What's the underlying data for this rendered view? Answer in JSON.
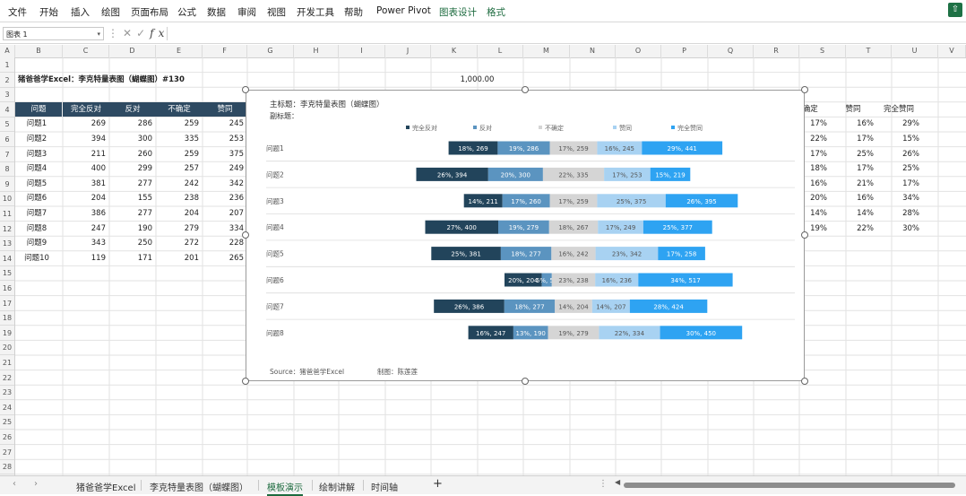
{
  "ribbon": {
    "tabs": [
      "文件",
      "开始",
      "插入",
      "绘图",
      "页面布局",
      "公式",
      "数据",
      "审阅",
      "视图",
      "开发工具",
      "帮助",
      "Power Pivot",
      "图表设计",
      "格式"
    ]
  },
  "formula_bar": {
    "name_box": "图表 1",
    "content": ""
  },
  "columns": [
    "A",
    "B",
    "C",
    "D",
    "E",
    "F",
    "G",
    "H",
    "I",
    "J",
    "K",
    "L",
    "M",
    "N",
    "O",
    "P",
    "Q",
    "R",
    "S",
    "T",
    "U",
    "V"
  ],
  "rows": [
    "1",
    "2",
    "3",
    "4",
    "5",
    "6",
    "7",
    "8",
    "9",
    "10",
    "11",
    "12",
    "13",
    "14",
    "15",
    "16",
    "17",
    "18",
    "19",
    "20",
    "21",
    "22",
    "23",
    "24",
    "25",
    "26",
    "27",
    "28"
  ],
  "sheet": {
    "title": "猪爸爸学Excel：李克特量表图（蝴蝶图）#130",
    "k2_value": "1,000.00",
    "table_headers": [
      "问题",
      "完全反对",
      "反对",
      "不确定",
      "赞同"
    ],
    "table_rows": [
      [
        "问题1",
        "269",
        "286",
        "259",
        "245"
      ],
      [
        "问题2",
        "394",
        "300",
        "335",
        "253"
      ],
      [
        "问题3",
        "211",
        "260",
        "259",
        "375"
      ],
      [
        "问题4",
        "400",
        "299",
        "257",
        "249"
      ],
      [
        "问题5",
        "381",
        "277",
        "242",
        "342"
      ],
      [
        "问题6",
        "204",
        "155",
        "238",
        "236"
      ],
      [
        "问题7",
        "386",
        "277",
        "204",
        "207"
      ],
      [
        "问题8",
        "247",
        "190",
        "279",
        "334"
      ],
      [
        "问题9",
        "343",
        "250",
        "272",
        "228"
      ],
      [
        "问题10",
        "119",
        "171",
        "201",
        "265"
      ]
    ],
    "right_headers": [
      "不确定",
      "赞同",
      "完全赞同"
    ],
    "right_rows": [
      [
        "17%",
        "16%",
        "29%"
      ],
      [
        "22%",
        "17%",
        "15%"
      ],
      [
        "17%",
        "25%",
        "26%"
      ],
      [
        "18%",
        "17%",
        "25%"
      ],
      [
        "16%",
        "21%",
        "17%"
      ],
      [
        "20%",
        "16%",
        "34%"
      ],
      [
        "14%",
        "14%",
        "28%"
      ],
      [
        "19%",
        "22%",
        "30%"
      ]
    ]
  },
  "chart": {
    "title": "主标题：李克特量表图（蝴蝶图）",
    "subtitle": "副标题：",
    "source": "Source：猪爸爸学Excel",
    "maker": "制图：陈莲莲",
    "legend": [
      "完全反对",
      "反对",
      "不确定",
      "赞同",
      "完全赞同"
    ],
    "colors": [
      "#22445b",
      "#5b94c0",
      "#d5d5d5",
      "#a8d2f2",
      "#2ea3f2"
    ]
  },
  "chart_data": {
    "type": "bar",
    "stacked": true,
    "orientation": "horizontal",
    "categories": [
      "问题1",
      "问题2",
      "问题3",
      "问题4",
      "问题5",
      "问题6",
      "问题7",
      "问题8"
    ],
    "series": [
      {
        "name": "完全反对",
        "values": [
          269,
          394,
          211,
          400,
          381,
          204,
          386,
          247
        ],
        "labels": [
          "18%, 269",
          "26%, 394",
          "14%, 211",
          "27%, 400",
          "25%, 381",
          "20%, 204",
          "26%, 386",
          "16%, 247"
        ]
      },
      {
        "name": "反对",
        "values": [
          286,
          300,
          260,
          279,
          277,
          55,
          277,
          190
        ],
        "labels": [
          "19%, 286",
          "20%, 300",
          "17%, 260",
          "19%, 279",
          "18%, 277",
          "5%, 55",
          "18%, 277",
          "13%, 190"
        ]
      },
      {
        "name": "不确定",
        "values": [
          259,
          335,
          259,
          267,
          242,
          238,
          204,
          279
        ],
        "labels": [
          "17%, 259",
          "22%, 335",
          "17%, 259",
          "18%, 267",
          "16%, 242",
          "23%, 238",
          "14%, 204",
          "19%, 279"
        ]
      },
      {
        "name": "赞同",
        "values": [
          245,
          253,
          375,
          249,
          342,
          236,
          207,
          334
        ],
        "labels": [
          "16%, 245",
          "17%, 253",
          "25%, 375",
          "17%, 249",
          "23%, 342",
          "16%, 236",
          "14%, 207",
          "22%, 334"
        ]
      },
      {
        "name": "完全赞同",
        "values": [
          441,
          219,
          395,
          377,
          258,
          517,
          424,
          450
        ],
        "labels": [
          "29%, 441",
          "15%, 219",
          "26%, 395",
          "25%, 377",
          "17%, 258",
          "34%, 517",
          "28%, 424",
          "30%, 450"
        ]
      }
    ]
  },
  "sheet_tabs": [
    "猪爸爸学Excel",
    "李克特量表图（蝴蝶图）",
    "模板演示",
    "绘制讲解",
    "时间轴"
  ],
  "active_sheet_tab": "模板演示"
}
